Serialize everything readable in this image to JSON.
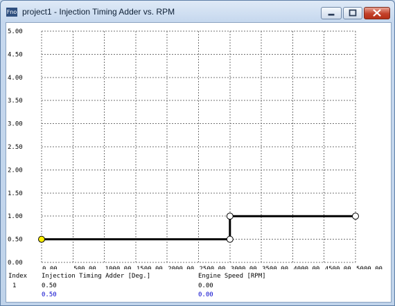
{
  "window": {
    "icon_text": "Fno",
    "title": "project1 - Injection Timing Adder vs. RPM"
  },
  "chart_data": {
    "type": "line",
    "x_label": "",
    "y_label": "",
    "xlim": [
      0,
      5000
    ],
    "ylim": [
      0,
      5
    ],
    "grid": true,
    "x_ticks": [
      "0.00",
      "500.00",
      "1000.00",
      "1500.00",
      "2000.00",
      "2500.00",
      "3000.00",
      "3500.00",
      "4000.00",
      "4500.00",
      "5000.00"
    ],
    "y_ticks": [
      "0.00",
      "0.50",
      "1.00",
      "1.50",
      "2.00",
      "2.50",
      "3.00",
      "3.50",
      "4.00",
      "4.50",
      "5.00"
    ],
    "series": [
      {
        "color": "#000000",
        "points": [
          {
            "x": 0,
            "y": 0.5,
            "selected": true
          },
          {
            "x": 3000,
            "y": 0.5,
            "selected": false
          },
          {
            "x": 3000,
            "y": 1.0,
            "selected": false
          },
          {
            "x": 5000,
            "y": 1.0,
            "selected": false
          }
        ]
      }
    ]
  },
  "table": {
    "headers": [
      "Index",
      "Injection Timing Adder [Deg.]",
      "Engine Speed [RPM]"
    ],
    "row_index": "1",
    "adder_value": "0.50",
    "speed_value": "0.00",
    "adder_edit": "0.50",
    "speed_edit": "0.00"
  },
  "colors": {
    "selected_point": "#ffee00",
    "point_fill": "#ffffff",
    "grid": "#707070",
    "edit_text": "#0000cc"
  }
}
